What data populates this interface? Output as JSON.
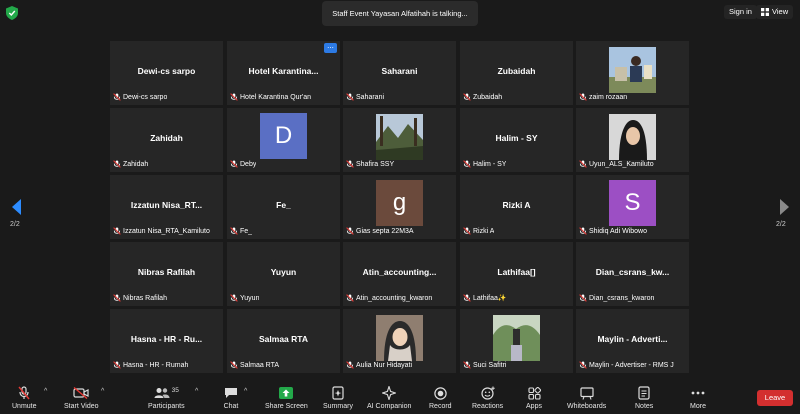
{
  "topbar": {
    "talking_text": "Staff Event Yayasan Alfatihah is talking...",
    "signin_label": "Sign in",
    "view_label": "View"
  },
  "pagination": {
    "left": "2/2",
    "right": "2/2"
  },
  "tiles": [
    {
      "big": "Dewi-cs sarpo",
      "label": "Dewi-cs sarpo"
    },
    {
      "big": "Hotel  Karantina...",
      "label": "Hotel Karantina Qur'an"
    },
    {
      "big": "Saharani",
      "label": "Saharani"
    },
    {
      "big": "Zubaidah",
      "label": "Zubaidah"
    },
    {
      "big": "",
      "label": "zaim rozaan"
    },
    {
      "big": "Zahidah",
      "label": "Zahidah"
    },
    {
      "big": "",
      "label": "Deby",
      "initial": "D"
    },
    {
      "big": "",
      "label": "Shafira SSY"
    },
    {
      "big": "Halim - SY",
      "label": "Halim - SY"
    },
    {
      "big": "",
      "label": "Uyun_ALS_Kamiluto"
    },
    {
      "big": "Izzatun  Nisa_RT...",
      "label": "Izzatun Nisa_RTA_Kamiluto"
    },
    {
      "big": "Fe_",
      "label": "Fe_"
    },
    {
      "big": "",
      "label": "Gias septa 22M3A",
      "initial": "g"
    },
    {
      "big": "Rizki A",
      "label": "Rizki A"
    },
    {
      "big": "",
      "label": "Shidiq Adi Wibowo",
      "initial": "S"
    },
    {
      "big": "Nibras Rafilah",
      "label": "Nibras Rafilah"
    },
    {
      "big": "Yuyun",
      "label": "Yuyun"
    },
    {
      "big": "Atin_accounting...",
      "label": "Atin_accounting_kwaron"
    },
    {
      "big": "Lathifaa[]",
      "label": "Lathifaa✨"
    },
    {
      "big": "Dian_csrans_kw...",
      "label": "Dian_csrans_kwaron"
    },
    {
      "big": "Hasna - HR - Ru...",
      "label": "Hasna - HR - Rumah"
    },
    {
      "big": "Salmaa RTA",
      "label": "Salmaa RTA"
    },
    {
      "big": "",
      "label": "Aulia Nur Hidayati"
    },
    {
      "big": "",
      "label": "Suci Safitri"
    },
    {
      "big": "Maylin - Adverti...",
      "label": "Maylin - Advertiser - RMS J"
    }
  ],
  "toolbar": {
    "unmute": "Unmute",
    "start_video": "Start Video",
    "participants": "Participants",
    "participants_count": "35",
    "chat": "Chat",
    "share_screen": "Share Screen",
    "summary": "Summary",
    "ai_companion": "AI Companion",
    "record": "Record",
    "reactions": "Reactions",
    "apps": "Apps",
    "whiteboards": "Whiteboards",
    "notes": "Notes",
    "more": "More",
    "leave": "Leave"
  },
  "colors": {
    "avatar_D": "#5a6fc4",
    "avatar_g": "#6b4a3c",
    "avatar_S": "#9c4fc4",
    "share_green": "#23a94a",
    "leave_red": "#d32f2f",
    "more_dots_blue": "#2d7be5"
  }
}
